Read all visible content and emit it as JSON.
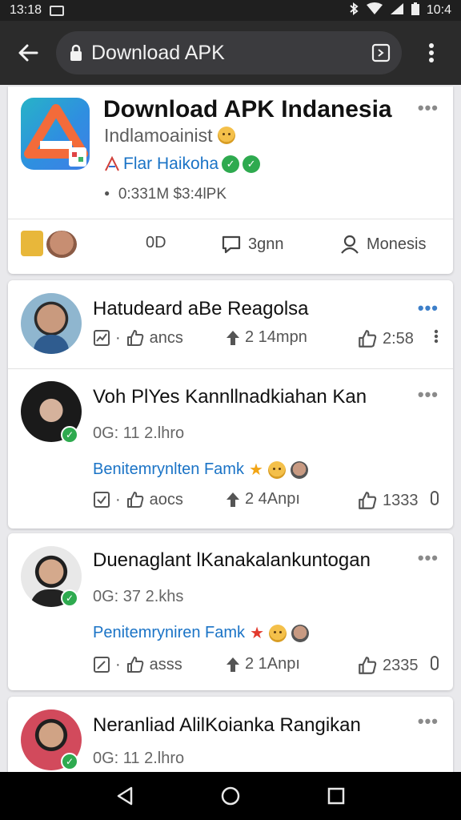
{
  "status_bar": {
    "time_left": "13:18",
    "time_right": "10:4"
  },
  "toolbar": {
    "url_text": "Download APK"
  },
  "app": {
    "title": "Download APK Indanesia",
    "subtitle": "Indlamoainist",
    "author": "Flar Haikoha",
    "meta": "0:331M  $3:4lPK",
    "actions": {
      "count": "0D",
      "comment": "3gnn",
      "share": "Monesis"
    }
  },
  "posts": [
    {
      "title": "Hatudeard aBe Reagolsa",
      "actions": {
        "views": "ancs",
        "boost": "2 14mpn",
        "likes": "2:58"
      }
    },
    {
      "title": "Voh PlYes Kannllnadkiahan Kan",
      "time": "0G: 11 2.lhro",
      "link": "Benitemrynlten Famk",
      "actions": {
        "views": "aocs",
        "boost": "2 4Anpı",
        "likes": "1333"
      }
    },
    {
      "title": "Duenaglant lKanakalankuntogan",
      "time": "0G: 37 2.khs",
      "link": "Penitemryniren Famk",
      "actions": {
        "views": "asss",
        "boost": "2 1Anpı",
        "likes": "2335"
      }
    },
    {
      "title": "Neranliad AlilKoianka Rangikan",
      "time": "0G: 11 2.lhro"
    }
  ],
  "colors": {
    "accent_blue": "#1a73c6",
    "toolbar": "#2b2b2b",
    "verified_green": "#2eaa4f"
  }
}
